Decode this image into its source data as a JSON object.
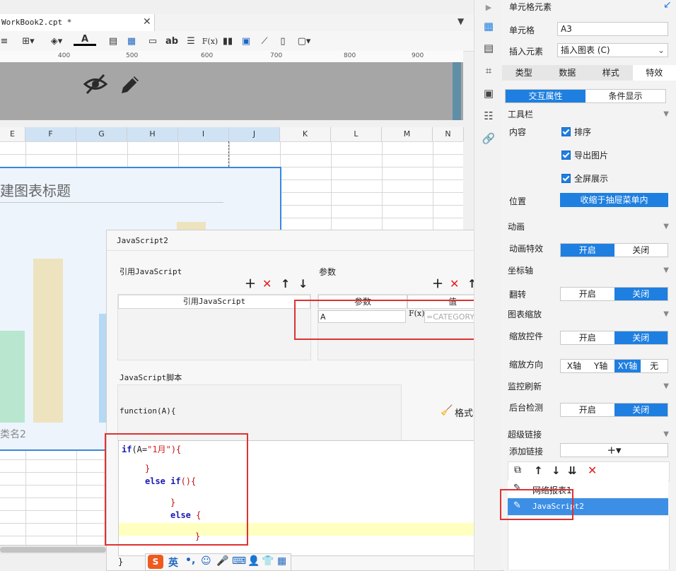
{
  "editor": {
    "tab_title": "WorkBook2.cpt *",
    "ruler_ticks": [
      "400",
      "500",
      "600",
      "700",
      "800",
      "900"
    ],
    "columns": [
      "E",
      "F",
      "G",
      "H",
      "I",
      "J",
      "K",
      "L",
      "M",
      "N"
    ],
    "chart_title_partial": "建图表标题",
    "chart_category_partial": "类名2",
    "font_color_letter": "A",
    "text_tool": "ab",
    "formula_tool": "F(x)"
  },
  "dialog": {
    "title": "JavaScript2",
    "ref_js_section": "引用JavaScript",
    "ref_js_header": "引用JavaScript",
    "params_section": "参数",
    "params_headers": [
      "参数",
      "值"
    ],
    "param_row": {
      "name": "A",
      "fx": "F(x)",
      "value": "=CATEGORY"
    },
    "script_section": "JavaScript脚本",
    "function_signature": "function(A){",
    "format_code_label": "格式化代码",
    "code": {
      "line1_kw": "if",
      "line1_a": "(A=",
      "line1_str": "\"1月\"",
      "line1_b": "){",
      "line2": "}",
      "line3_kw": "else if",
      "line3_b": "(){",
      "line4": "}",
      "line5_kw": "else",
      "line5_b": " {",
      "line6": "}"
    },
    "closing_brace": "}"
  },
  "ime": {
    "logo": "S",
    "lang": "英",
    "punct": "•,"
  },
  "right_panel": {
    "header_title": "单元格元素",
    "cell_label": "单元格",
    "cell_value": "A3",
    "insert_label": "插入元素",
    "insert_value": "插入图表 (C)",
    "tabs": [
      "类型",
      "数据",
      "样式",
      "特效"
    ],
    "subtabs": [
      "交互属性",
      "条件显示"
    ],
    "toolbar_section": "工具栏",
    "content_label": "内容",
    "checks": [
      "排序",
      "导出图片",
      "全屏展示"
    ],
    "position_label": "位置",
    "position_value": "收缩于抽屉菜单内",
    "animation_section": "动画",
    "animation_effect_label": "动画特效",
    "on": "开启",
    "off": "关闭",
    "axis_section": "坐标轴",
    "flip_label": "翻转",
    "zoom_section": "图表缩放",
    "zoom_control_label": "缩放控件",
    "zoom_dir_label": "缩放方向",
    "zoom_dirs": [
      "X轴",
      "Y轴",
      "XY轴",
      "无"
    ],
    "refresh_section": "监控刷新",
    "bg_check_label": "后台检测",
    "hyperlink_section": "超级链接",
    "add_link_label": "添加链接",
    "add_link_btn": "+▾",
    "links": [
      "网络报表1",
      "JavaScript2"
    ]
  },
  "colors": {
    "accent": "#1e7fe0",
    "highlight_red": "#e03131",
    "chart_border": "#3b86e0"
  }
}
